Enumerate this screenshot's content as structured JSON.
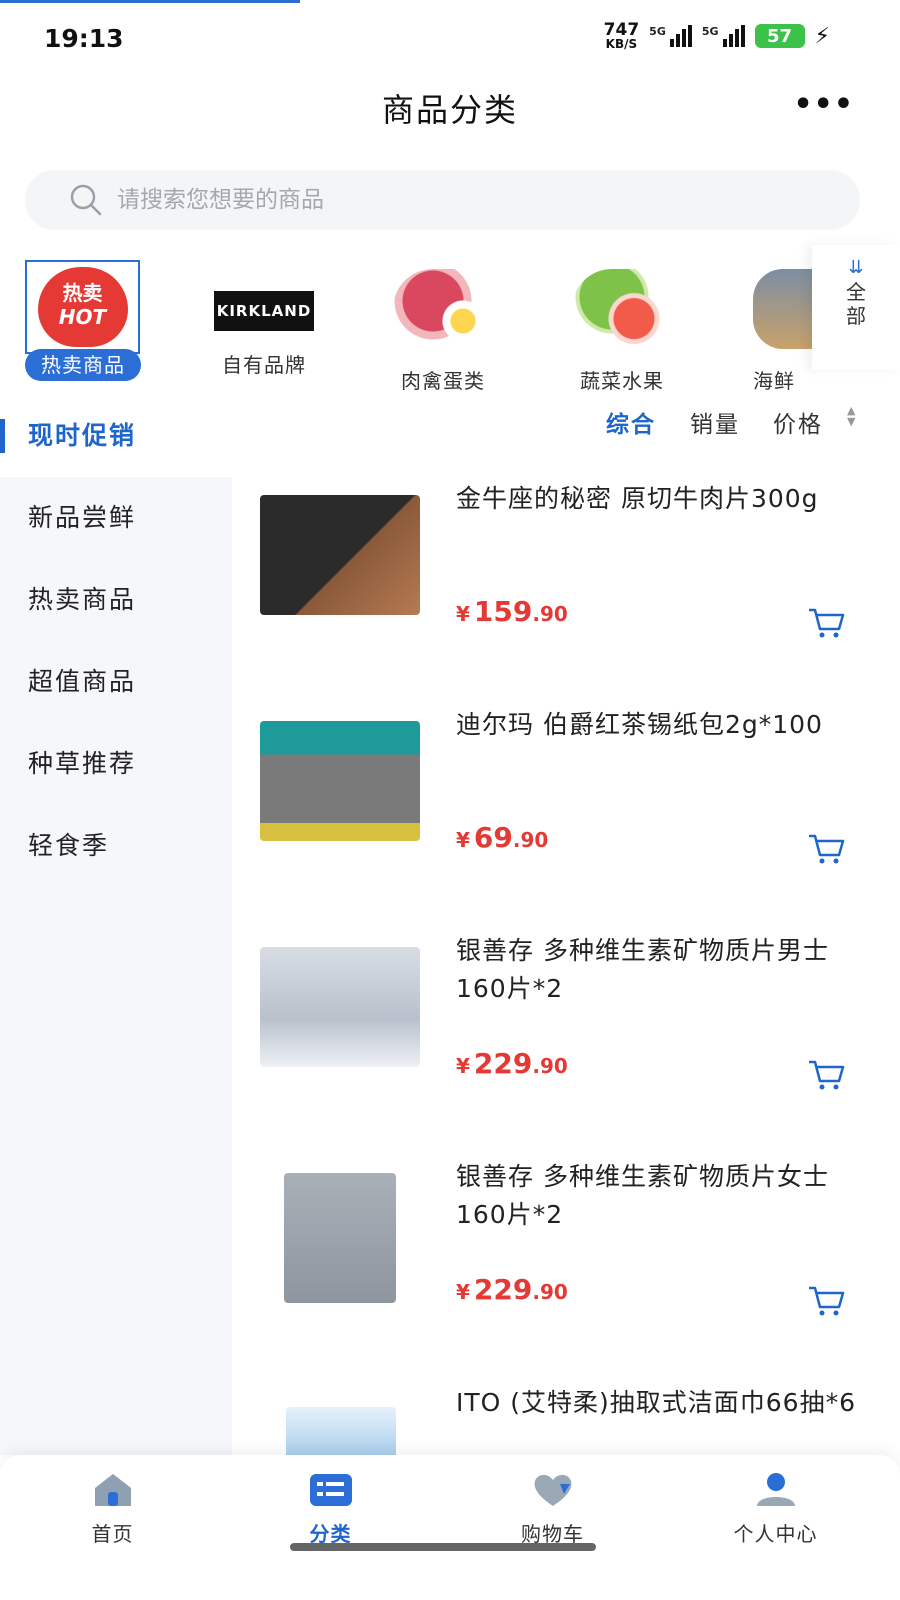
{
  "status_bar": {
    "time": "19:13",
    "net_speed": "747",
    "net_unit": "KB/S",
    "sim1": "5G",
    "sim2": "5G",
    "battery": "57"
  },
  "header": {
    "title": "商品分类",
    "more_icon": "more-icon"
  },
  "search": {
    "placeholder": "请搜索您想要的商品"
  },
  "categories": {
    "items": [
      {
        "label": "热卖商品",
        "badge_line1": "热卖",
        "badge_line2": "HOT",
        "selected": true
      },
      {
        "label": "自有品牌",
        "logo_text": "KIRKLAND"
      },
      {
        "label": "肉禽蛋类"
      },
      {
        "label": "蔬菜水果"
      },
      {
        "label": "海鲜"
      }
    ],
    "all_label": "全部"
  },
  "sidebar": {
    "items": [
      {
        "label": "现时促销",
        "active": true
      },
      {
        "label": "新品尝鲜"
      },
      {
        "label": "热卖商品"
      },
      {
        "label": "超值商品"
      },
      {
        "label": "种草推荐"
      },
      {
        "label": "轻食季"
      }
    ]
  },
  "sort": {
    "comprehensive": "综合",
    "sales": "销量",
    "price": "价格"
  },
  "products": [
    {
      "name": "金牛座的秘密 原切牛肉片300g",
      "currency": "¥",
      "price_int": "159",
      "price_dec": ".90",
      "image": "beef-package"
    },
    {
      "name": "迪尔玛 伯爵红茶锡纸包2g*100",
      "currency": "¥",
      "price_int": "69",
      "price_dec": ".90",
      "image": "tea-box"
    },
    {
      "name": "银善存 多种维生素矿物质片男士160片*2",
      "currency": "¥",
      "price_int": "229",
      "price_dec": ".90",
      "image": "centrum-men"
    },
    {
      "name": "银善存 多种维生素矿物质片女士160片*2",
      "currency": "¥",
      "price_int": "229",
      "price_dec": ".90",
      "image": "centrum-women"
    },
    {
      "name": "ITO (艾特柔)抽取式洁面巾66抽*6",
      "image": "face-towel"
    }
  ],
  "tabbar": {
    "items": [
      {
        "label": "首页"
      },
      {
        "label": "分类",
        "active": true
      },
      {
        "label": "购物车"
      },
      {
        "label": "个人中心"
      }
    ]
  },
  "colors": {
    "accent": "#1f66cc",
    "price": "#e53935",
    "sidebar_bg": "#f5f7fa"
  }
}
